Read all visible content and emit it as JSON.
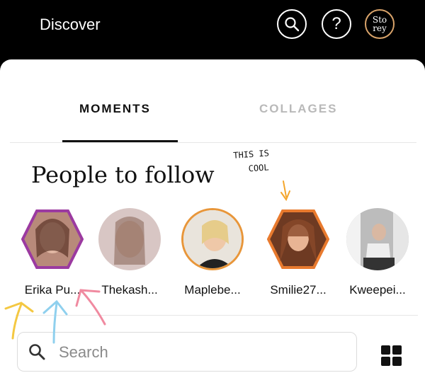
{
  "header": {
    "title": "Discover",
    "storey_line1": "Sto",
    "storey_line2": "rey",
    "help_label": "?"
  },
  "tabs": [
    {
      "label": "MOMENTS",
      "active": true
    },
    {
      "label": "COLLAGES",
      "active": false
    }
  ],
  "section": {
    "title": "People to follow"
  },
  "annotation": {
    "line1": "THIS IS",
    "line2": "COOL"
  },
  "people": [
    {
      "name": "Erika Pu...",
      "ring": "#9b3aa0"
    },
    {
      "name": "Thekash...",
      "ring": "none"
    },
    {
      "name": "Maplebe...",
      "ring": "#e8963a"
    },
    {
      "name": "Smilie27...",
      "ring": "#e87a2e"
    },
    {
      "name": "Kweepei...",
      "ring": "none"
    }
  ],
  "search": {
    "placeholder": "Search"
  },
  "colors": {
    "accent_orange": "#e8963a",
    "accent_purple": "#9b3aa0",
    "arrow_yellow": "#f4c842",
    "arrow_blue": "#8fd0ee",
    "arrow_pink": "#f08aa0"
  }
}
